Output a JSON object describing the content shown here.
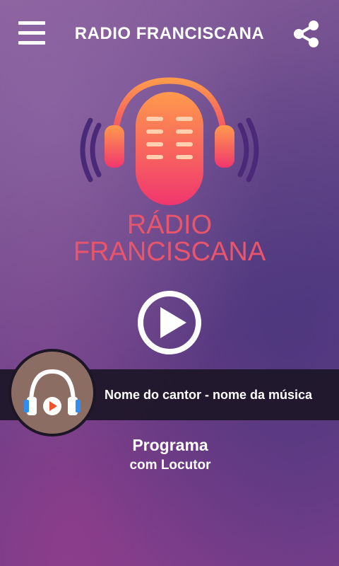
{
  "header": {
    "title": "RADIO FRANCISCANA",
    "menu_icon": "hamburger-menu-icon",
    "share_icon": "share-icon"
  },
  "logo": {
    "line1": "RÁDIO",
    "line2": "FRANCISCANA",
    "icon": "microphone-headphones-logo",
    "colors": {
      "mic_top": "#ff8a4a",
      "mic_bottom": "#f33c6c",
      "waves": "#4a2a78",
      "text": "#e9556a"
    }
  },
  "player": {
    "play_icon": "play-icon",
    "now_playing": "Nome do cantor - nome da música",
    "cover_icon": "headphones-play-icon"
  },
  "program": {
    "title": "Programa",
    "host": "com Locutor"
  },
  "colors": {
    "background": "#6a4a8c",
    "bar": "#1c1626",
    "cover_bg": "#8c6d63"
  }
}
